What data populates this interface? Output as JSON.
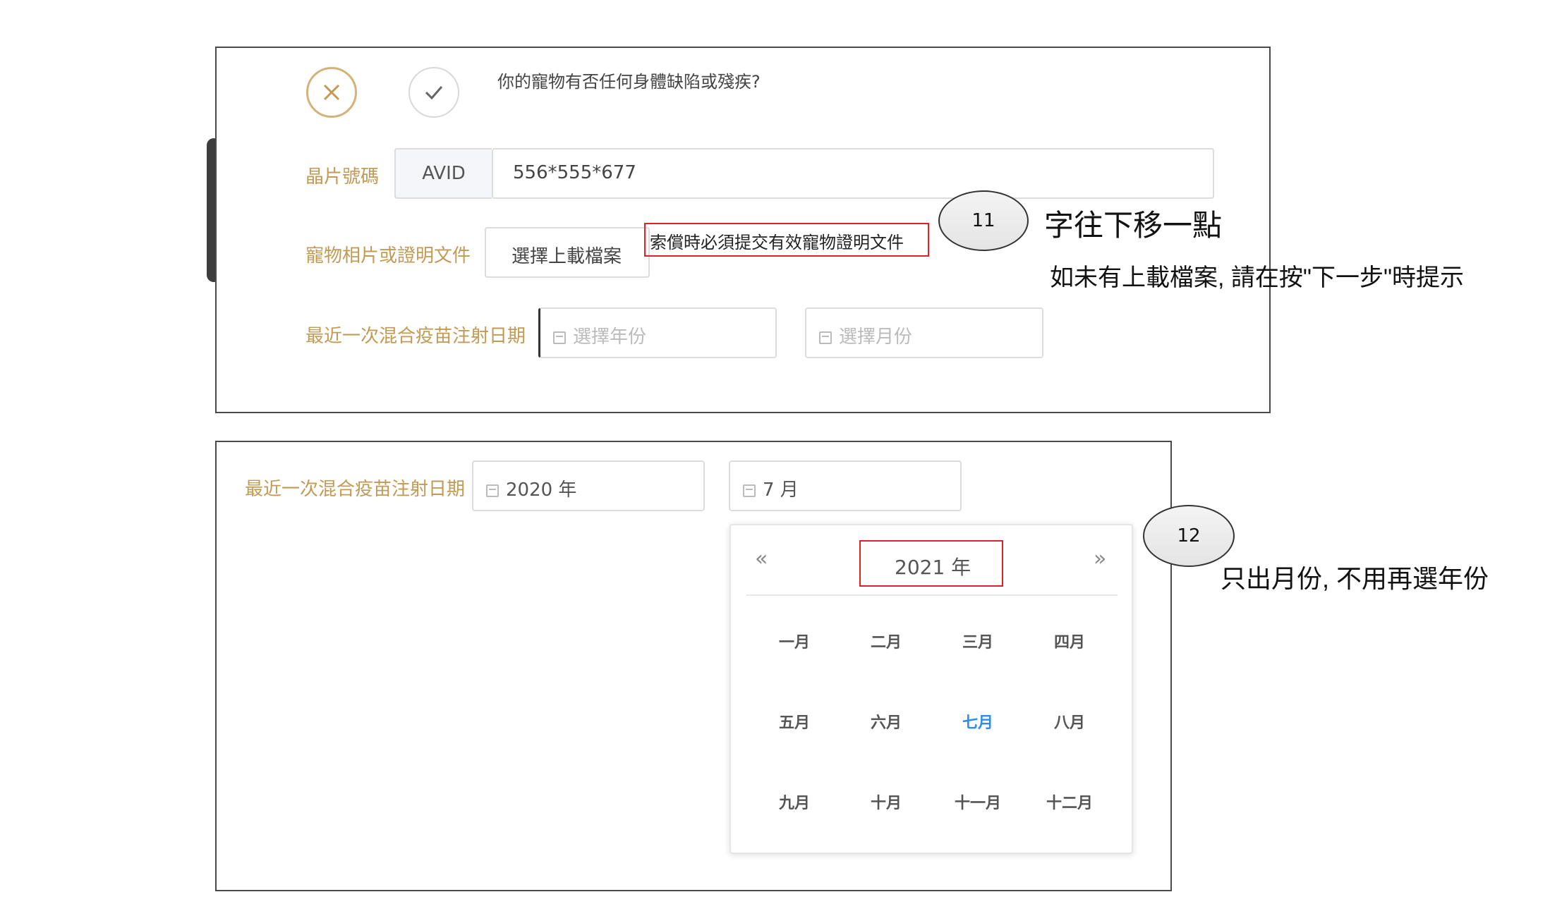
{
  "panel1": {
    "question": "你的寵物有否任何身體缺陷或殘疾?",
    "chip_label": "晶片號碼",
    "chip_prefix": "AVID",
    "chip_value": "556*555*677",
    "photo_label": "寵物相片或證明文件",
    "upload_button": "選擇上載檔案",
    "upload_hint": "索償時必須提交有效寵物證明文件",
    "vaccine_label": "最近一次混合疫苗注射日期",
    "year_placeholder": "選擇年份",
    "month_placeholder": "選擇月份"
  },
  "panel2": {
    "vaccine_label": "最近一次混合疫苗注射日期",
    "year_value": "2020 年",
    "month_value": "7 月",
    "picker": {
      "prev": "«",
      "next": "»",
      "year": "2021 年",
      "months": [
        "一月",
        "二月",
        "三月",
        "四月",
        "五月",
        "六月",
        "七月",
        "八月",
        "九月",
        "十月",
        "十一月",
        "十二月"
      ],
      "selected_index": 6
    }
  },
  "annotations": {
    "a11": {
      "number": "11",
      "title": "字往下移一點",
      "note": "如未有上載檔案, 請在按\"下一步\"時提示"
    },
    "a12": {
      "number": "12",
      "note": "只出月份, 不用再選年份"
    }
  },
  "colors": {
    "label_gold": "#c39a55",
    "accent_blue": "#2d8cf0",
    "annotation_red": "#e0202a"
  }
}
